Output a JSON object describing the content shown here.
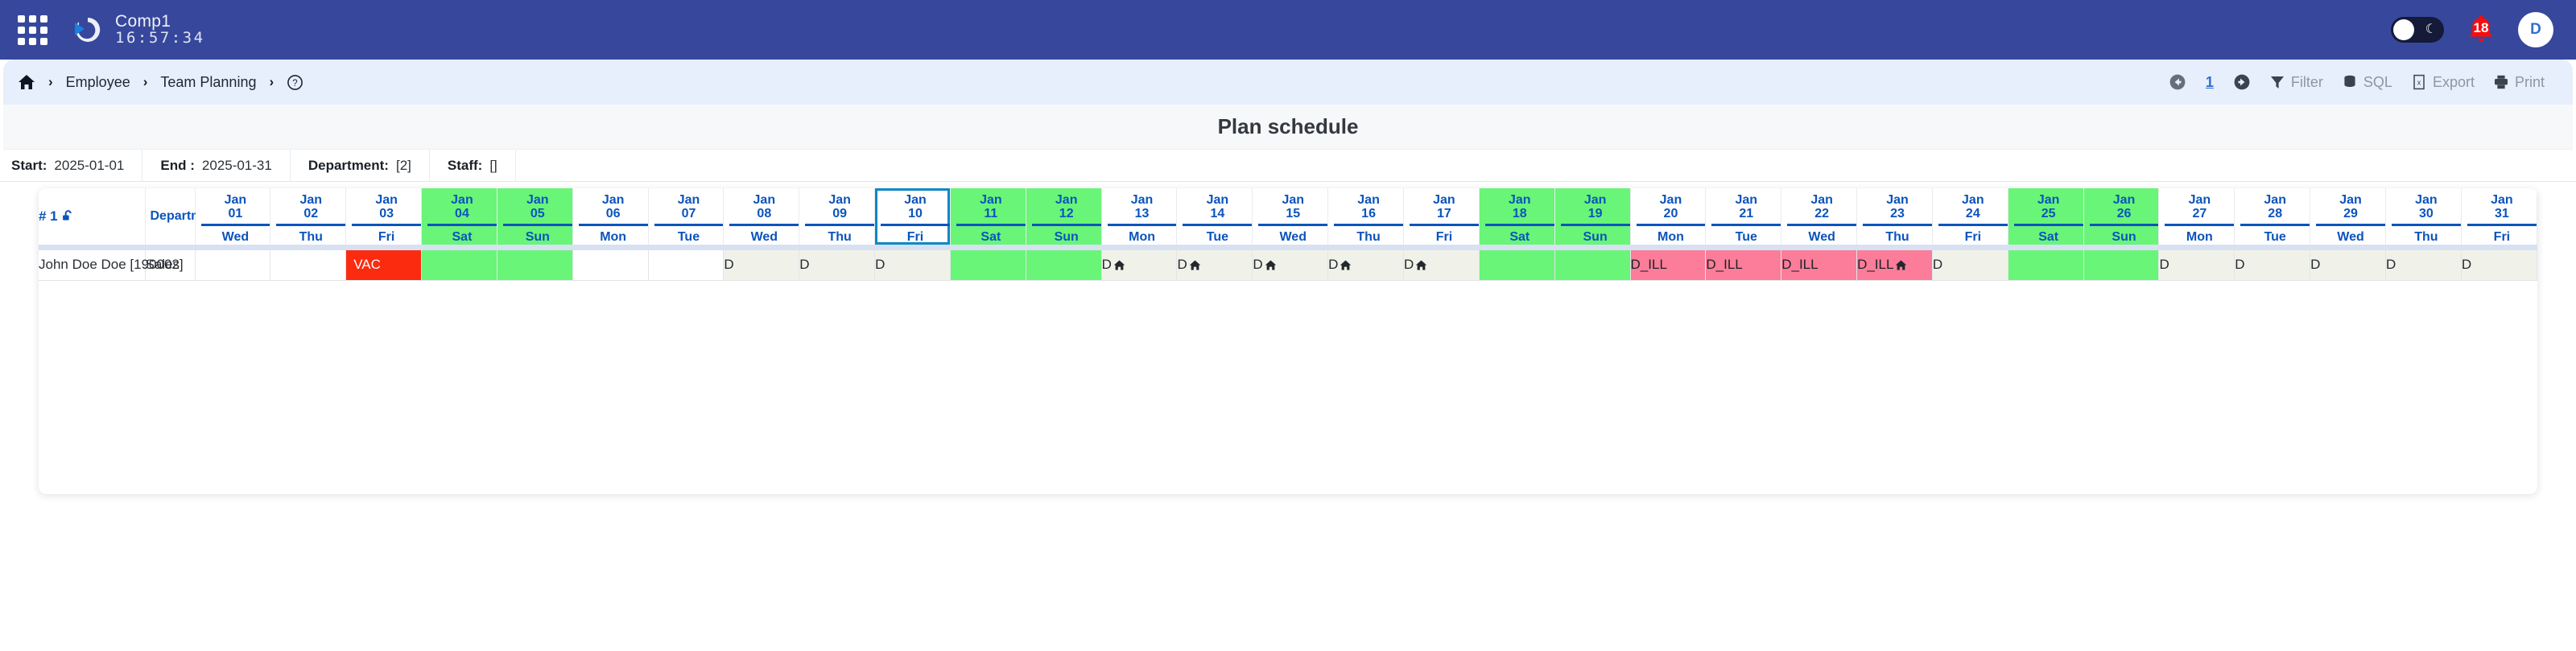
{
  "appbar": {
    "apps_icon": "grid-apps-icon",
    "logo_icon": "circular-play-logo",
    "company": "Comp1",
    "clock": "16:57:34",
    "theme_toggle_icon": "moon-icon",
    "bell_icon": "bell-icon",
    "notification_count": "18",
    "avatar_initial": "D",
    "colors": {
      "bar": "#37479b",
      "bell": "#fb0b0b",
      "avatar_text": "#2f6fd0"
    }
  },
  "breadcrumb": {
    "home_icon": "home-icon",
    "separator": "›",
    "items": [
      {
        "label": "Employee"
      },
      {
        "label": "Team Planning"
      }
    ],
    "help_icon": "question-circle-icon"
  },
  "toolbar": {
    "prev_icon": "arrow-left-circle-icon",
    "page_number": "1",
    "next_icon": "arrow-right-circle-icon",
    "actions": [
      {
        "icon": "filter-funnel-icon",
        "label": "Filter"
      },
      {
        "icon": "database-icon",
        "label": "SQL"
      },
      {
        "icon": "excel-file-icon",
        "label": "Export"
      },
      {
        "icon": "printer-icon",
        "label": "Print"
      }
    ]
  },
  "page": {
    "title": "Plan schedule"
  },
  "filters": [
    {
      "key": "Start:",
      "value": "2025-01-01"
    },
    {
      "key": "End :",
      "value": "2025-01-31"
    },
    {
      "key": "Department:",
      "value": "[2]"
    },
    {
      "key": "Staff:",
      "value": "[]"
    }
  ],
  "grid": {
    "row_count_label": "# 1",
    "lock_icon": "unlock-icon",
    "name_header": "",
    "dept_header": "Department",
    "today_date": "Jan 10",
    "days": [
      {
        "date": "Jan 01",
        "dow": "Wed",
        "weekend": false
      },
      {
        "date": "Jan 02",
        "dow": "Thu",
        "weekend": false
      },
      {
        "date": "Jan 03",
        "dow": "Fri",
        "weekend": false
      },
      {
        "date": "Jan 04",
        "dow": "Sat",
        "weekend": true
      },
      {
        "date": "Jan 05",
        "dow": "Sun",
        "weekend": true
      },
      {
        "date": "Jan 06",
        "dow": "Mon",
        "weekend": false
      },
      {
        "date": "Jan 07",
        "dow": "Tue",
        "weekend": false
      },
      {
        "date": "Jan 08",
        "dow": "Wed",
        "weekend": false
      },
      {
        "date": "Jan 09",
        "dow": "Thu",
        "weekend": false
      },
      {
        "date": "Jan 10",
        "dow": "Fri",
        "weekend": false
      },
      {
        "date": "Jan 11",
        "dow": "Sat",
        "weekend": true
      },
      {
        "date": "Jan 12",
        "dow": "Sun",
        "weekend": true
      },
      {
        "date": "Jan 13",
        "dow": "Mon",
        "weekend": false
      },
      {
        "date": "Jan 14",
        "dow": "Tue",
        "weekend": false
      },
      {
        "date": "Jan 15",
        "dow": "Wed",
        "weekend": false
      },
      {
        "date": "Jan 16",
        "dow": "Thu",
        "weekend": false
      },
      {
        "date": "Jan 17",
        "dow": "Fri",
        "weekend": false
      },
      {
        "date": "Jan 18",
        "dow": "Sat",
        "weekend": true
      },
      {
        "date": "Jan 19",
        "dow": "Sun",
        "weekend": true
      },
      {
        "date": "Jan 20",
        "dow": "Mon",
        "weekend": false
      },
      {
        "date": "Jan 21",
        "dow": "Tue",
        "weekend": false
      },
      {
        "date": "Jan 22",
        "dow": "Wed",
        "weekend": false
      },
      {
        "date": "Jan 23",
        "dow": "Thu",
        "weekend": false
      },
      {
        "date": "Jan 24",
        "dow": "Fri",
        "weekend": false
      },
      {
        "date": "Jan 25",
        "dow": "Sat",
        "weekend": true
      },
      {
        "date": "Jan 26",
        "dow": "Sun",
        "weekend": true
      },
      {
        "date": "Jan 27",
        "dow": "Mon",
        "weekend": false
      },
      {
        "date": "Jan 28",
        "dow": "Tue",
        "weekend": false
      },
      {
        "date": "Jan 29",
        "dow": "Wed",
        "weekend": false
      },
      {
        "date": "Jan 30",
        "dow": "Thu",
        "weekend": false
      },
      {
        "date": "Jan 31",
        "dow": "Fri",
        "weekend": false
      }
    ],
    "rows": [
      {
        "name": "John Doe Doe [190002]",
        "department": "Sales",
        "cells": [
          {
            "text": "",
            "kind": "empty",
            "home": false
          },
          {
            "text": "",
            "kind": "empty",
            "home": false
          },
          {
            "text": "VAC",
            "kind": "vac",
            "home": false
          },
          {
            "text": "",
            "kind": "weekend",
            "home": false
          },
          {
            "text": "",
            "kind": "weekend",
            "home": false
          },
          {
            "text": "",
            "kind": "empty",
            "home": false
          },
          {
            "text": "",
            "kind": "empty",
            "home": false
          },
          {
            "text": "D",
            "kind": "duty",
            "home": false
          },
          {
            "text": "D",
            "kind": "duty",
            "home": false
          },
          {
            "text": "D",
            "kind": "duty",
            "home": false
          },
          {
            "text": "",
            "kind": "weekend",
            "home": false
          },
          {
            "text": "",
            "kind": "weekend",
            "home": false
          },
          {
            "text": "D",
            "kind": "duty",
            "home": true
          },
          {
            "text": "D",
            "kind": "duty",
            "home": true
          },
          {
            "text": "D",
            "kind": "duty",
            "home": true
          },
          {
            "text": "D",
            "kind": "duty",
            "home": true
          },
          {
            "text": "D",
            "kind": "duty",
            "home": true
          },
          {
            "text": "",
            "kind": "weekend",
            "home": false
          },
          {
            "text": "",
            "kind": "weekend",
            "home": false
          },
          {
            "text": "D_ILL",
            "kind": "ill",
            "home": false
          },
          {
            "text": "D_ILL",
            "kind": "ill",
            "home": false
          },
          {
            "text": "D_ILL",
            "kind": "ill",
            "home": false
          },
          {
            "text": "D_ILL",
            "kind": "ill",
            "home": true
          },
          {
            "text": "D",
            "kind": "duty",
            "home": false
          },
          {
            "text": "",
            "kind": "weekend",
            "home": false
          },
          {
            "text": "",
            "kind": "weekend",
            "home": false
          },
          {
            "text": "D",
            "kind": "duty",
            "home": false
          },
          {
            "text": "D",
            "kind": "duty",
            "home": false
          },
          {
            "text": "D",
            "kind": "duty",
            "home": false
          },
          {
            "text": "D",
            "kind": "duty",
            "home": false
          },
          {
            "text": "D",
            "kind": "duty",
            "home": false
          }
        ]
      }
    ],
    "colors": {
      "weekend": "#69f577",
      "vacation": "#fb2b10",
      "illness": "#fb7d9a",
      "duty": "#f0f2e9",
      "header_text": "#0b54bd",
      "today_border": "#0e88c4"
    }
  }
}
